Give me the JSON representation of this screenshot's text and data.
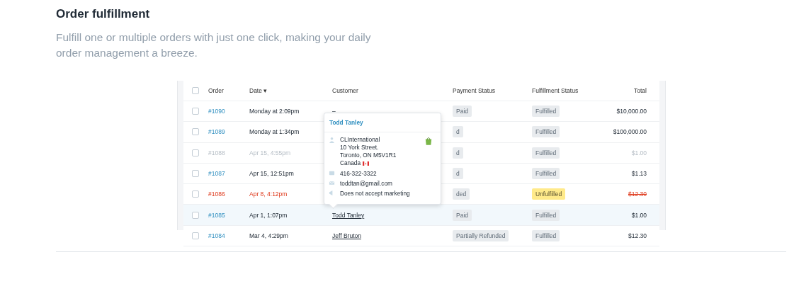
{
  "section": {
    "title": "Order fulfillment",
    "description": "Fulfill one or multiple orders with just one click, making your daily order management a breeze."
  },
  "table": {
    "all_checked": false,
    "columns": [
      {
        "label": "Order",
        "kind": "text"
      },
      {
        "label": "Date ▾",
        "kind": "text"
      },
      {
        "label": "Customer",
        "kind": "text"
      },
      {
        "label": "Payment Status",
        "kind": "text"
      },
      {
        "label": "Fulfillment Status",
        "kind": "text"
      },
      {
        "label": "Total",
        "kind": "number"
      }
    ],
    "rows": [
      {
        "order": "#1090",
        "date": "Monday at 2:09pm",
        "customer": "–",
        "payment": "Paid",
        "fulfillment": "Fulfilled",
        "fulfilled": true,
        "total": "$10,000.00",
        "kind": "normal",
        "selected": false,
        "checked": false
      },
      {
        "order": "#1089",
        "date": "Monday at 1:34pm",
        "customer": "",
        "payment": "d",
        "fulfillment": "Fulfilled",
        "fulfilled": true,
        "total": "$100,000.00",
        "kind": "normal",
        "selected": false,
        "checked": false
      },
      {
        "order": "#1088",
        "date": "Apr 15, 4:55pm",
        "customer": "",
        "payment": "d",
        "fulfillment": "Fulfilled",
        "fulfilled": true,
        "total": "$1.00",
        "kind": "archived",
        "selected": false,
        "checked": false
      },
      {
        "order": "#1087",
        "date": "Apr 15, 12:51pm",
        "customer": "",
        "payment": "d",
        "fulfillment": "Fulfilled",
        "fulfilled": true,
        "total": "$1.13",
        "kind": "normal",
        "selected": false,
        "checked": false
      },
      {
        "order": "#1086",
        "date": "Apr 8, 4:12pm",
        "customer": "",
        "payment": "ded",
        "fulfillment": "Unfulfilled",
        "fulfilled": false,
        "total": "$12.30",
        "kind": "cancelled",
        "selected": false,
        "checked": false
      },
      {
        "order": "#1085",
        "date": "Apr 1, 1:07pm",
        "customer": "Todd Tanley",
        "payment": "Paid",
        "fulfillment": "Fulfilled",
        "fulfilled": true,
        "total": "$1.00",
        "kind": "normal",
        "selected": true,
        "checked": false
      },
      {
        "order": "#1084",
        "date": "Mar 4, 4:29pm",
        "customer": "Jeff Bruton",
        "payment": "Partially Refunded",
        "fulfillment": "Fulfilled",
        "fulfilled": true,
        "total": "$12.30",
        "kind": "normal",
        "selected": false,
        "checked": false
      }
    ]
  },
  "popover": {
    "name": "Todd Tanley",
    "address": [
      "CLInternational",
      "10 York Street.",
      "Toronto, ON M5V1R1",
      "Canada"
    ],
    "phone": "416-322-3322",
    "email": "toddtan@gmail.com",
    "marketing": "Does not accept marketing"
  }
}
